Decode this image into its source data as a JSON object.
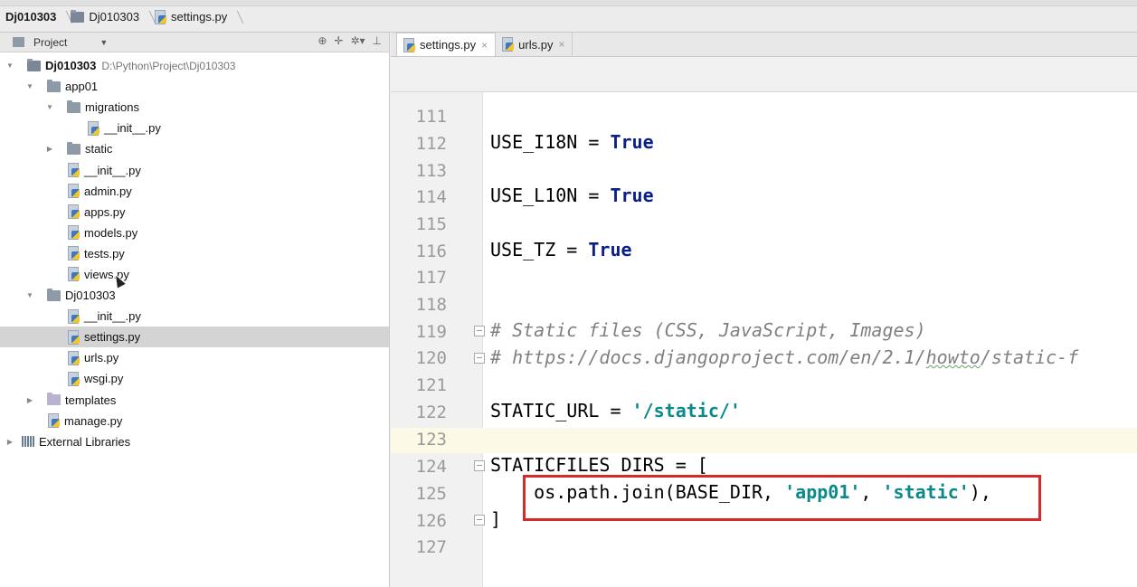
{
  "breadcrumb": {
    "items": [
      "Dj010303",
      "Dj010303",
      "settings.py"
    ]
  },
  "project_panel": {
    "title": "Project",
    "dropdown_icon": "triangle-down",
    "tools": [
      "target-icon",
      "collapse-icon",
      "gear-icon",
      "hide-icon"
    ]
  },
  "tree": [
    {
      "label": "Dj010303",
      "sub": "D:\\Python\\Project\\Dj010303",
      "type": "root",
      "expanded": true
    },
    {
      "label": "app01",
      "type": "folder",
      "expanded": true
    },
    {
      "label": "migrations",
      "type": "folder",
      "expanded": true
    },
    {
      "label": "__init__.py",
      "type": "file"
    },
    {
      "label": "static",
      "type": "folder",
      "expanded": false
    },
    {
      "label": "__init__.py",
      "type": "file"
    },
    {
      "label": "admin.py",
      "type": "file"
    },
    {
      "label": "apps.py",
      "type": "file"
    },
    {
      "label": "models.py",
      "type": "file"
    },
    {
      "label": "tests.py",
      "type": "file"
    },
    {
      "label": "views.py",
      "type": "file"
    },
    {
      "label": "Dj010303",
      "type": "folder",
      "expanded": true
    },
    {
      "label": "__init__.py",
      "type": "file"
    },
    {
      "label": "settings.py",
      "type": "file",
      "selected": true
    },
    {
      "label": "urls.py",
      "type": "file"
    },
    {
      "label": "wsgi.py",
      "type": "file"
    },
    {
      "label": "templates",
      "type": "folder",
      "expanded": false
    },
    {
      "label": "manage.py",
      "type": "file"
    },
    {
      "label": "External Libraries",
      "type": "lib",
      "expanded": false
    }
  ],
  "tabs": [
    {
      "label": "settings.py",
      "active": true
    },
    {
      "label": "urls.py",
      "active": false
    }
  ],
  "editor": {
    "line_numbers": [
      "111",
      "112",
      "113",
      "114",
      "115",
      "116",
      "117",
      "118",
      "119",
      "120",
      "121",
      "122",
      "123",
      "124",
      "125",
      "126",
      "127"
    ],
    "lines": {
      "l112a": "USE_I18N = ",
      "l112b": "True",
      "l114a": "USE_L10N = ",
      "l114b": "True",
      "l116a": "USE_TZ = ",
      "l116b": "True",
      "l119": "# Static files (CSS, JavaScript, Images)",
      "l120a": "# https://docs.djangoproject.com/en/2.1/",
      "l120b": "howto",
      "l120c": "/static-f",
      "l122a": "STATIC_URL = ",
      "l122b": "'/static/'",
      "l124": "STATICFILES_DIRS = [",
      "l125a": "    os.path.join(BASE_DIR, ",
      "l125b": "'app01'",
      "l125c": ", ",
      "l125d": "'static'",
      "l125e": "),",
      "l126": "]"
    }
  },
  "colors": {
    "keyword": "#0a1f8a",
    "string": "#0a8a8a",
    "comment": "#808080",
    "highlight_box": "#d62b2b",
    "current_line": "#fcfae6"
  }
}
